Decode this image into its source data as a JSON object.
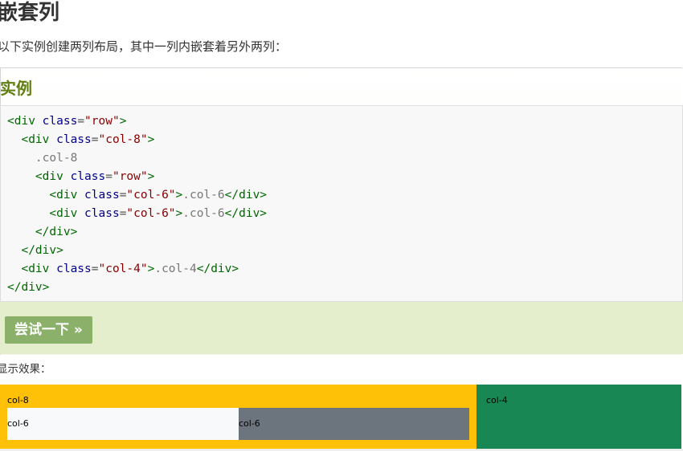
{
  "heading": "嵌套列",
  "intro": "以下实例创建两列布局，其中一列内嵌套着另外两列：",
  "example": {
    "title": "实例",
    "code_lines": [
      [
        {
          "t": "tag",
          "v": "<div "
        },
        {
          "t": "attr",
          "v": "class"
        },
        {
          "t": "eq",
          "v": "="
        },
        {
          "t": "str",
          "v": "\"row\""
        },
        {
          "t": "tag",
          "v": ">"
        }
      ],
      [
        {
          "t": "tag",
          "v": "  <div "
        },
        {
          "t": "attr",
          "v": "class"
        },
        {
          "t": "eq",
          "v": "="
        },
        {
          "t": "str",
          "v": "\"col-8\""
        },
        {
          "t": "tag",
          "v": ">"
        }
      ],
      [
        {
          "t": "text",
          "v": "    .col-8"
        }
      ],
      [
        {
          "t": "tag",
          "v": "    <div "
        },
        {
          "t": "attr",
          "v": "class"
        },
        {
          "t": "eq",
          "v": "="
        },
        {
          "t": "str",
          "v": "\"row\""
        },
        {
          "t": "tag",
          "v": ">"
        }
      ],
      [
        {
          "t": "tag",
          "v": "      <div "
        },
        {
          "t": "attr",
          "v": "class"
        },
        {
          "t": "eq",
          "v": "="
        },
        {
          "t": "str",
          "v": "\"col-6\""
        },
        {
          "t": "tag",
          "v": ">"
        },
        {
          "t": "text",
          "v": ".col-6"
        },
        {
          "t": "tag",
          "v": "</div>"
        }
      ],
      [
        {
          "t": "tag",
          "v": "      <div "
        },
        {
          "t": "attr",
          "v": "class"
        },
        {
          "t": "eq",
          "v": "="
        },
        {
          "t": "str",
          "v": "\"col-6\""
        },
        {
          "t": "tag",
          "v": ">"
        },
        {
          "t": "text",
          "v": ".col-6"
        },
        {
          "t": "tag",
          "v": "</div>"
        }
      ],
      [
        {
          "t": "tag",
          "v": "    </div>"
        }
      ],
      [
        {
          "t": "tag",
          "v": "  </div>"
        }
      ],
      [
        {
          "t": "tag",
          "v": "  <div "
        },
        {
          "t": "attr",
          "v": "class"
        },
        {
          "t": "eq",
          "v": "="
        },
        {
          "t": "str",
          "v": "\"col-4\""
        },
        {
          "t": "tag",
          "v": ">"
        },
        {
          "t": "text",
          "v": ".col-4"
        },
        {
          "t": "tag",
          "v": "</div>"
        }
      ],
      [
        {
          "t": "tag",
          "v": "</div>"
        }
      ]
    ],
    "try_button": "尝试一下 »"
  },
  "result": {
    "label": "显示效果：",
    "col8_label": "col-8",
    "col6_first_label": "col-6",
    "col6_second_label": "col-6",
    "col4_label": "col-4"
  },
  "colors": {
    "col8_bg": "#ffc107",
    "col4_bg": "#198754",
    "col6_first_bg": "#f8f9fa",
    "col6_second_bg": "#6c757d",
    "example_title": "#617f10",
    "try_button_bg": "#8ab06a"
  }
}
